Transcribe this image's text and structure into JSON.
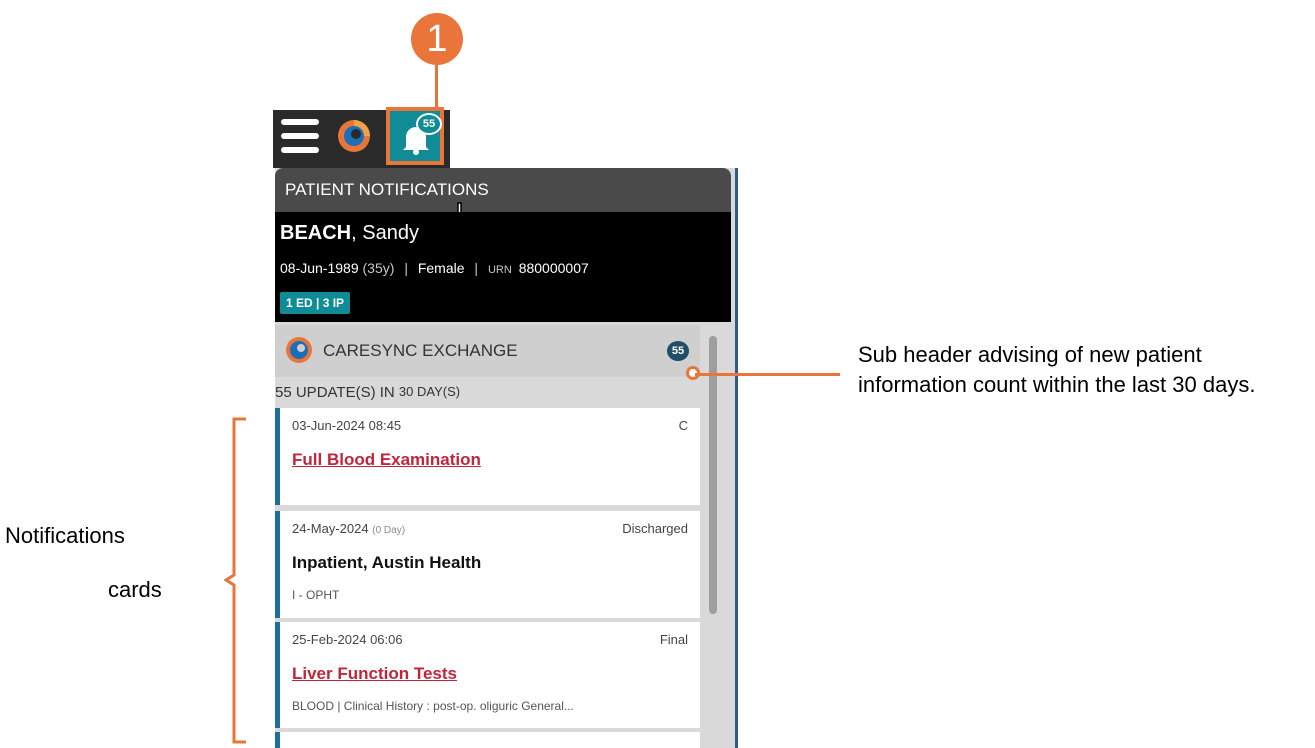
{
  "callout": {
    "step_number": "1"
  },
  "toolbar": {
    "menu_icon": "hamburger-menu-icon",
    "app_logo_icon": "caresync-logo-icon",
    "notifications_icon": "bell-icon",
    "notifications_badge": "55"
  },
  "panel": {
    "header_title": "PATIENT NOTIFICATIONS"
  },
  "patient": {
    "surname": "BEACH",
    "given_name": ", Sandy",
    "dob": "08-Jun-1989",
    "age": "(35y)",
    "gender": "Female",
    "urn_label": "URN",
    "urn": "880000007",
    "encounters": "1 ED | 3 IP"
  },
  "exchange": {
    "title": "CARESYNC EXCHANGE",
    "count": "55",
    "update_prefix": "55 UPDATE(S) IN",
    "update_period": "30 DAY(S)"
  },
  "cards": [
    {
      "date": "03-Jun-2024",
      "time": "08:45",
      "status": "C",
      "title": "Full Blood Examination",
      "subtitle": ""
    },
    {
      "date": "24-May-2024",
      "time": "(0 Day)",
      "status": "Discharged",
      "title": "Inpatient, Austin Health",
      "subtitle": "I - OPHT"
    },
    {
      "date": "25-Feb-2024",
      "time": "06:06",
      "status": "Final",
      "title": "Liver Function Tests",
      "subtitle": "BLOOD | Clinical History : post-op. oliguric General..."
    }
  ],
  "annotations": {
    "subheader_note": "Sub header advising of new patient information count within the last 30 days.",
    "cards_note_line1": "Notifications",
    "cards_note_line2": "cards"
  },
  "colors": {
    "accent_orange": "#e9753a",
    "teal": "#0f8c96",
    "link_red": "#c0263a"
  }
}
